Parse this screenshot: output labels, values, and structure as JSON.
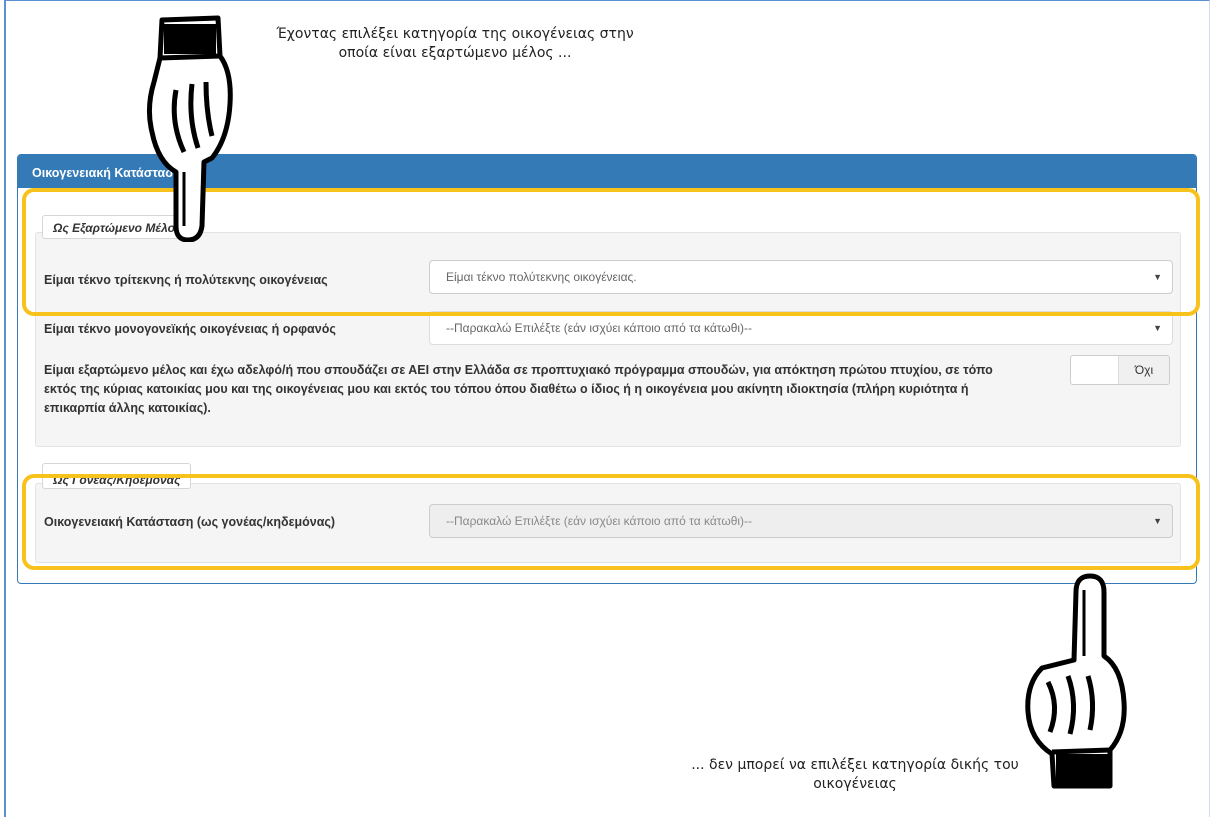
{
  "annotations": {
    "top_note": "Έχοντας επιλέξει κατηγορία της οικογένειας στην οποία είναι εξαρτώμενο μέλος ...",
    "bottom_note": "... δεν μπορεί να επιλέξει κατηγορία δικής του οικογένειας",
    "highlight_color": "#f8c21c"
  },
  "panel": {
    "title": "Οικογενειακή Κατάσταση",
    "header_color": "#337ab7"
  },
  "dependent_section": {
    "legend": "Ως Εξαρτώμενο Μέλος",
    "large_family": {
      "label": "Είμαι τέκνο τρίτεκνης ή πολύτεκνης οικογένειας",
      "value": "Είμαι τέκνο πολύτεκνης οικογένειας."
    },
    "single_parent": {
      "label": "Είμαι τέκνο μονογονεϊκής οικογένειας ή ορφανός",
      "value": "--Παρακαλώ Επιλέξτε (εάν ισχύει κάποιο από τα κάτωθι)--"
    },
    "sibling_student": {
      "text": "Είμαι εξαρτώμενο μέλος και έχω αδελφό/ή που σπουδάζει σε ΑΕΙ στην Ελλάδα σε προπτυχιακό πρόγραμμα σπουδών, για απόκτηση πρώτου πτυχίου, σε τόπο εκτός της κύριας κατοικίας μου και της οικογένειας μου και εκτός του τόπου όπου διαθέτω ο ίδιος ή η οικογένεια μου ακίνητη ιδιοκτησία (πλήρη κυριότητα ή επικαρπία άλλης κατοικίας).",
      "toggle_value": "Όχι"
    }
  },
  "parent_section": {
    "legend": "Ως Γονέας/Κηδεμόνας",
    "family_status": {
      "label": "Οικογενειακή Κατάσταση (ως γονέας/κηδεμόνας)",
      "value": "--Παρακαλώ Επιλέξτε (εάν ισχύει κάποιο από τα κάτωθι)--"
    }
  },
  "icons": {
    "dropdown": "caret-down-icon",
    "pointer_top": "pointing-hand-down-icon",
    "pointer_bottom": "pointing-hand-up-icon"
  }
}
